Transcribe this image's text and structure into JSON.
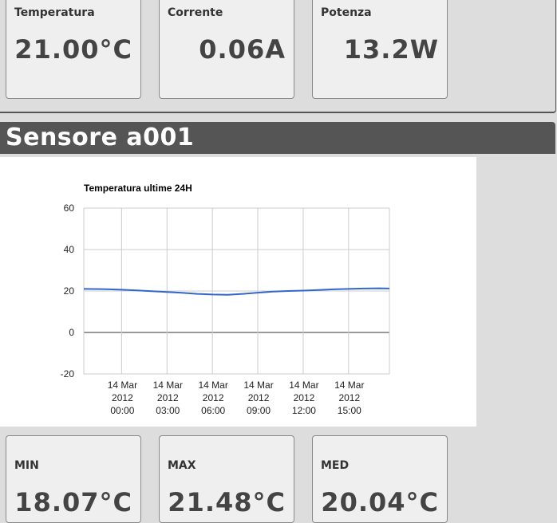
{
  "top_stats": [
    {
      "label": "Temperatura",
      "value": "21.00°C"
    },
    {
      "label": "Corrente",
      "value": "0.06A"
    },
    {
      "label": "Potenza",
      "value": "13.2W"
    }
  ],
  "section": {
    "title": "Sensore a001"
  },
  "chart_data": {
    "type": "line",
    "title": "Temperatura ultime 24H",
    "y_ticks": [
      "60",
      "40",
      "20",
      "0",
      "-20"
    ],
    "ylim": [
      -20,
      60
    ],
    "x_ticks": [
      {
        "l1": "14 Mar",
        "l2": "2012",
        "l3": "00:00"
      },
      {
        "l1": "14 Mar",
        "l2": "2012",
        "l3": "03:00"
      },
      {
        "l1": "14 Mar",
        "l2": "2012",
        "l3": "06:00"
      },
      {
        "l1": "14 Mar",
        "l2": "2012",
        "l3": "09:00"
      },
      {
        "l1": "14 Mar",
        "l2": "2012",
        "l3": "12:00"
      },
      {
        "l1": "14 Mar",
        "l2": "2012",
        "l3": "15:00"
      }
    ],
    "xlim_hours": [
      -2.5,
      17.7
    ],
    "series": [
      {
        "color": "#3366cc",
        "x": [
          -2.5,
          -1,
          0,
          1,
          2,
          3,
          4,
          5,
          6,
          7,
          8,
          9,
          10,
          11,
          12,
          13,
          14,
          15,
          16,
          17,
          17.7
        ],
        "y": [
          21.0,
          20.9,
          20.6,
          20.3,
          19.9,
          19.5,
          19.1,
          18.6,
          18.3,
          18.2,
          18.6,
          19.2,
          19.7,
          20.0,
          20.2,
          20.5,
          20.8,
          21.0,
          21.2,
          21.3,
          21.2
        ]
      }
    ],
    "grid": true
  },
  "bottom_stats": [
    {
      "label": "MIN",
      "value": "18.07°C"
    },
    {
      "label": "MAX",
      "value": "21.48°C"
    },
    {
      "label": "MED",
      "value": "20.04°C"
    }
  ]
}
